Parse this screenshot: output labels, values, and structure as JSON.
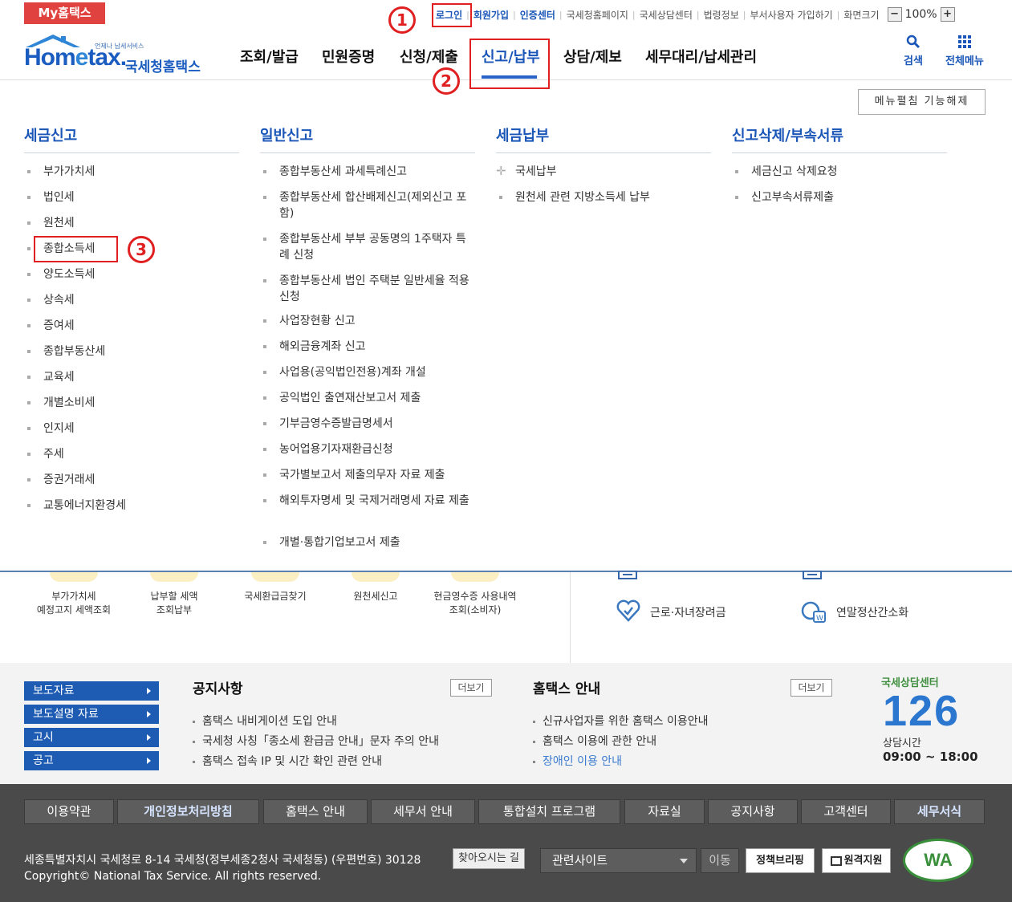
{
  "util": {
    "my_hometax": "My홈택스",
    "links": [
      "로그인",
      "회원가입",
      "인증센터",
      "국세청홈페이지",
      "국세상담센터",
      "법령정보",
      "부서사용자 가입하기",
      "화면크기"
    ],
    "zoom_minus": "−",
    "zoom_value": "100%",
    "zoom_plus": "+"
  },
  "header": {
    "logo_small": "언제나 납세서비스",
    "logo_brand_1": "Hom",
    "logo_brand_e": "e",
    "logo_brand_2": "tax.",
    "logo_korean": "국세청홈택스",
    "gnb": [
      "조회/발급",
      "민원증명",
      "신청/제출",
      "신고/납부",
      "상담/제보",
      "세무대리/납세관리"
    ],
    "search_label": "검색",
    "allmenu_label": "전체메뉴"
  },
  "mega": {
    "fold_button": "메뉴펼침 기능해제",
    "columns": [
      {
        "title": "세금신고",
        "items": [
          "부가가치세",
          "법인세",
          "원천세",
          "종합소득세",
          "양도소득세",
          "상속세",
          "증여세",
          "종합부동산세",
          "교육세",
          "개별소비세",
          "인지세",
          "주세",
          "증권거래세",
          "교통에너지환경세"
        ]
      },
      {
        "title": "일반신고",
        "items": [
          "종합부동산세 과세특례신고",
          "종합부동산세 합산배제신고(제외신고 포함)",
          "종합부동산세 부부 공동명의 1주택자 특례 신청",
          "종합부동산세 법인 주택분 일반세율 적용 신청",
          "사업장현황 신고",
          "해외금융계좌 신고",
          "사업용(공익법인전용)계좌 개설",
          "공익법인 출연재산보고서 제출",
          "기부금영수증발급명세서",
          "농어업용기자재환급신청",
          "국가별보고서 제출의무자 자료 제출",
          "해외투자명세 및 국제거래명세 자료 제출",
          "개별·통합기업보고서 제출"
        ]
      },
      {
        "title": "세금납부",
        "items": [
          "국세납부",
          "원천세 관련 지방소득세 납부"
        ]
      },
      {
        "title": "신고삭제/부속서류",
        "items": [
          "세금신고 삭제요청",
          "신고부속서류제출"
        ]
      }
    ]
  },
  "annotations": [
    "1",
    "2",
    "3"
  ],
  "quick": [
    "부가가치세\n예정고지 세액조회",
    "납부할 세액\n조회납부",
    "국세환급금찾기",
    "원천세신고",
    "현금영수증 사용내역\n조회(소비자)"
  ],
  "right_links": [
    "근로·자녀장려금",
    "연말정산간소화"
  ],
  "side_buttons": [
    "보도자료",
    "보도설명 자료",
    "고시",
    "공고"
  ],
  "notice": {
    "title": "공지사항",
    "more": "더보기",
    "items": [
      "홈택스 내비게이션 도입 안내",
      "국세청 사칭「종소세 환급금 안내」문자 주의 안내",
      "홈택스 접속 IP 및 시간 확인 관련 안내"
    ]
  },
  "guide": {
    "title": "홈택스 안내",
    "more": "더보기",
    "items": [
      "신규사업자를 위한 홈택스 이용안내",
      "홈택스 이용에 관한 안내",
      "장애인 이용 안내"
    ]
  },
  "center": {
    "top": "국세상담센터",
    "number": "126",
    "hours_label": "상담시간",
    "hours": "09:00 ~ 18:00"
  },
  "footer": {
    "buttons": [
      "이용약관",
      "개인정보처리방침",
      "홈택스 안내",
      "세무서 안내",
      "통합설치 프로그램",
      "자료실",
      "공지사항",
      "고객센터",
      "세무서식"
    ],
    "address": "세종특별자치시 국세청로 8-14 국세청(정부세종2청사 국세청동) (우편번호) 30128",
    "find_button": "찾아오시는 길",
    "copyright": "Copyright© National Tax Service. All rights reserved.",
    "related_select": "관련사이트",
    "move_button": "이동",
    "policy_button": "정책브리핑",
    "remote_button": "원격지원",
    "wa_mark": "WA"
  },
  "colors": {
    "accent": "#1a56b8",
    "annotation": "#e02020",
    "footer_bg": "#4a4a4a"
  }
}
